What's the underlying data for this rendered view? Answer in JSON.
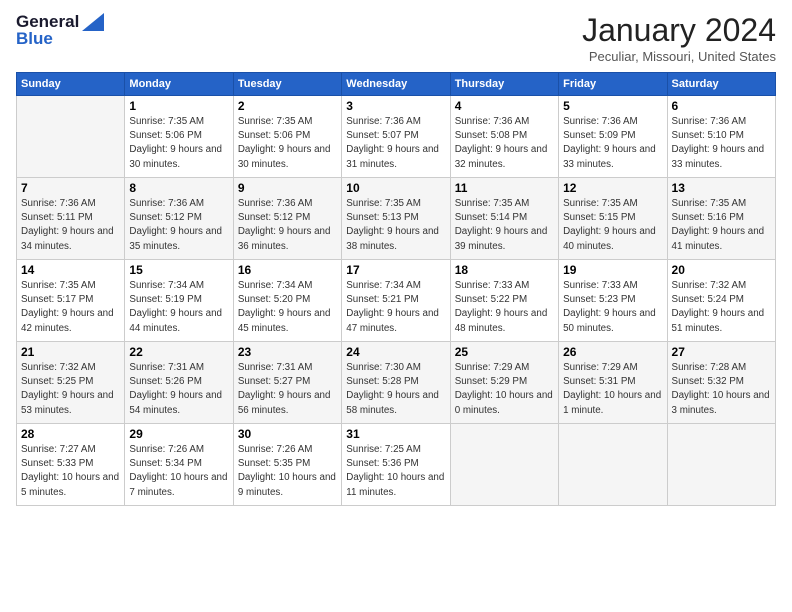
{
  "logo": {
    "general": "General",
    "blue": "Blue"
  },
  "header": {
    "month": "January 2024",
    "location": "Peculiar, Missouri, United States"
  },
  "days_of_week": [
    "Sunday",
    "Monday",
    "Tuesday",
    "Wednesday",
    "Thursday",
    "Friday",
    "Saturday"
  ],
  "weeks": [
    [
      {
        "day": "",
        "sunrise": "",
        "sunset": "",
        "daylight": ""
      },
      {
        "day": "1",
        "sunrise": "Sunrise: 7:35 AM",
        "sunset": "Sunset: 5:06 PM",
        "daylight": "Daylight: 9 hours and 30 minutes."
      },
      {
        "day": "2",
        "sunrise": "Sunrise: 7:35 AM",
        "sunset": "Sunset: 5:06 PM",
        "daylight": "Daylight: 9 hours and 30 minutes."
      },
      {
        "day": "3",
        "sunrise": "Sunrise: 7:36 AM",
        "sunset": "Sunset: 5:07 PM",
        "daylight": "Daylight: 9 hours and 31 minutes."
      },
      {
        "day": "4",
        "sunrise": "Sunrise: 7:36 AM",
        "sunset": "Sunset: 5:08 PM",
        "daylight": "Daylight: 9 hours and 32 minutes."
      },
      {
        "day": "5",
        "sunrise": "Sunrise: 7:36 AM",
        "sunset": "Sunset: 5:09 PM",
        "daylight": "Daylight: 9 hours and 33 minutes."
      },
      {
        "day": "6",
        "sunrise": "Sunrise: 7:36 AM",
        "sunset": "Sunset: 5:10 PM",
        "daylight": "Daylight: 9 hours and 33 minutes."
      }
    ],
    [
      {
        "day": "7",
        "sunrise": "Sunrise: 7:36 AM",
        "sunset": "Sunset: 5:11 PM",
        "daylight": "Daylight: 9 hours and 34 minutes."
      },
      {
        "day": "8",
        "sunrise": "Sunrise: 7:36 AM",
        "sunset": "Sunset: 5:12 PM",
        "daylight": "Daylight: 9 hours and 35 minutes."
      },
      {
        "day": "9",
        "sunrise": "Sunrise: 7:36 AM",
        "sunset": "Sunset: 5:12 PM",
        "daylight": "Daylight: 9 hours and 36 minutes."
      },
      {
        "day": "10",
        "sunrise": "Sunrise: 7:35 AM",
        "sunset": "Sunset: 5:13 PM",
        "daylight": "Daylight: 9 hours and 38 minutes."
      },
      {
        "day": "11",
        "sunrise": "Sunrise: 7:35 AM",
        "sunset": "Sunset: 5:14 PM",
        "daylight": "Daylight: 9 hours and 39 minutes."
      },
      {
        "day": "12",
        "sunrise": "Sunrise: 7:35 AM",
        "sunset": "Sunset: 5:15 PM",
        "daylight": "Daylight: 9 hours and 40 minutes."
      },
      {
        "day": "13",
        "sunrise": "Sunrise: 7:35 AM",
        "sunset": "Sunset: 5:16 PM",
        "daylight": "Daylight: 9 hours and 41 minutes."
      }
    ],
    [
      {
        "day": "14",
        "sunrise": "Sunrise: 7:35 AM",
        "sunset": "Sunset: 5:17 PM",
        "daylight": "Daylight: 9 hours and 42 minutes."
      },
      {
        "day": "15",
        "sunrise": "Sunrise: 7:34 AM",
        "sunset": "Sunset: 5:19 PM",
        "daylight": "Daylight: 9 hours and 44 minutes."
      },
      {
        "day": "16",
        "sunrise": "Sunrise: 7:34 AM",
        "sunset": "Sunset: 5:20 PM",
        "daylight": "Daylight: 9 hours and 45 minutes."
      },
      {
        "day": "17",
        "sunrise": "Sunrise: 7:34 AM",
        "sunset": "Sunset: 5:21 PM",
        "daylight": "Daylight: 9 hours and 47 minutes."
      },
      {
        "day": "18",
        "sunrise": "Sunrise: 7:33 AM",
        "sunset": "Sunset: 5:22 PM",
        "daylight": "Daylight: 9 hours and 48 minutes."
      },
      {
        "day": "19",
        "sunrise": "Sunrise: 7:33 AM",
        "sunset": "Sunset: 5:23 PM",
        "daylight": "Daylight: 9 hours and 50 minutes."
      },
      {
        "day": "20",
        "sunrise": "Sunrise: 7:32 AM",
        "sunset": "Sunset: 5:24 PM",
        "daylight": "Daylight: 9 hours and 51 minutes."
      }
    ],
    [
      {
        "day": "21",
        "sunrise": "Sunrise: 7:32 AM",
        "sunset": "Sunset: 5:25 PM",
        "daylight": "Daylight: 9 hours and 53 minutes."
      },
      {
        "day": "22",
        "sunrise": "Sunrise: 7:31 AM",
        "sunset": "Sunset: 5:26 PM",
        "daylight": "Daylight: 9 hours and 54 minutes."
      },
      {
        "day": "23",
        "sunrise": "Sunrise: 7:31 AM",
        "sunset": "Sunset: 5:27 PM",
        "daylight": "Daylight: 9 hours and 56 minutes."
      },
      {
        "day": "24",
        "sunrise": "Sunrise: 7:30 AM",
        "sunset": "Sunset: 5:28 PM",
        "daylight": "Daylight: 9 hours and 58 minutes."
      },
      {
        "day": "25",
        "sunrise": "Sunrise: 7:29 AM",
        "sunset": "Sunset: 5:29 PM",
        "daylight": "Daylight: 10 hours and 0 minutes."
      },
      {
        "day": "26",
        "sunrise": "Sunrise: 7:29 AM",
        "sunset": "Sunset: 5:31 PM",
        "daylight": "Daylight: 10 hours and 1 minute."
      },
      {
        "day": "27",
        "sunrise": "Sunrise: 7:28 AM",
        "sunset": "Sunset: 5:32 PM",
        "daylight": "Daylight: 10 hours and 3 minutes."
      }
    ],
    [
      {
        "day": "28",
        "sunrise": "Sunrise: 7:27 AM",
        "sunset": "Sunset: 5:33 PM",
        "daylight": "Daylight: 10 hours and 5 minutes."
      },
      {
        "day": "29",
        "sunrise": "Sunrise: 7:26 AM",
        "sunset": "Sunset: 5:34 PM",
        "daylight": "Daylight: 10 hours and 7 minutes."
      },
      {
        "day": "30",
        "sunrise": "Sunrise: 7:26 AM",
        "sunset": "Sunset: 5:35 PM",
        "daylight": "Daylight: 10 hours and 9 minutes."
      },
      {
        "day": "31",
        "sunrise": "Sunrise: 7:25 AM",
        "sunset": "Sunset: 5:36 PM",
        "daylight": "Daylight: 10 hours and 11 minutes."
      },
      {
        "day": "",
        "sunrise": "",
        "sunset": "",
        "daylight": ""
      },
      {
        "day": "",
        "sunrise": "",
        "sunset": "",
        "daylight": ""
      },
      {
        "day": "",
        "sunrise": "",
        "sunset": "",
        "daylight": ""
      }
    ]
  ]
}
